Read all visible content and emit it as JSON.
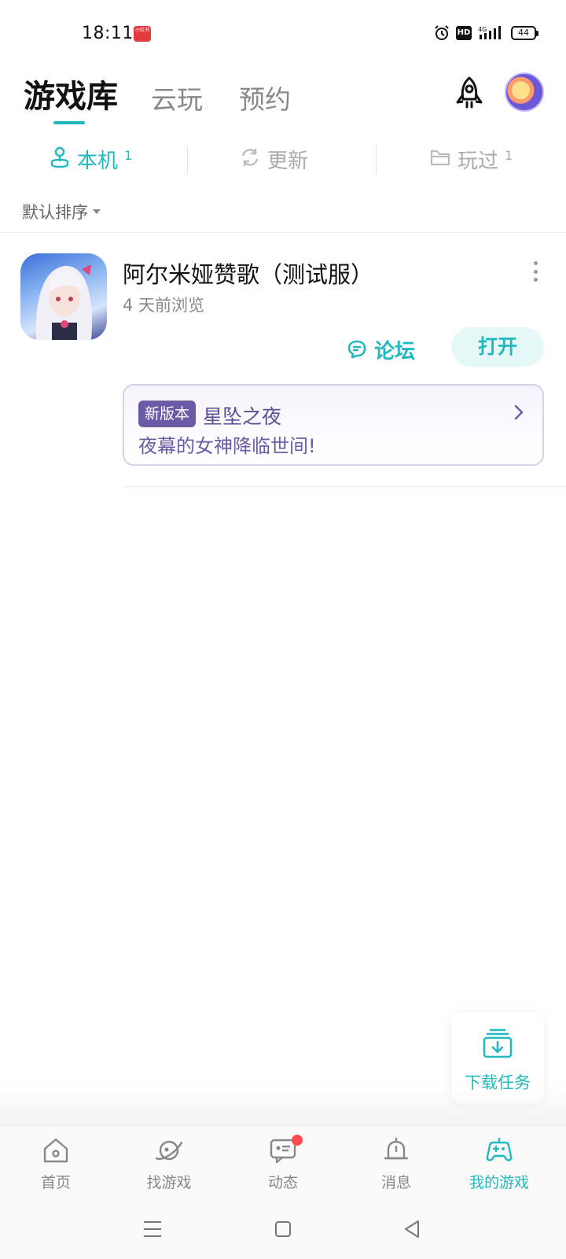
{
  "status": {
    "time": "18:11",
    "app_badge": "小红书",
    "hd": "HD",
    "battery": "44"
  },
  "header": {
    "tabs": [
      {
        "label": "游戏库",
        "active": true
      },
      {
        "label": "云玩",
        "active": false
      },
      {
        "label": "预约",
        "active": false
      }
    ]
  },
  "subtabs": [
    {
      "label": "本机",
      "count": "1",
      "active": true,
      "icon": "joystick-icon"
    },
    {
      "label": "更新",
      "count": "",
      "active": false,
      "icon": "refresh-icon"
    },
    {
      "label": "玩过",
      "count": "1",
      "active": false,
      "icon": "folder-icon"
    }
  ],
  "sort": {
    "label": "默认排序"
  },
  "game": {
    "title": "阿尔米娅赞歌（测试服）",
    "subtitle": "4 天前浏览",
    "forum_label": "论坛",
    "open_label": "打开",
    "news": {
      "badge": "新版本",
      "title": "星坠之夜",
      "desc": "夜幕的女神降临世间!"
    }
  },
  "download_task": {
    "label": "下载任务"
  },
  "bottom_nav": [
    {
      "label": "首页",
      "icon": "home-icon",
      "active": false
    },
    {
      "label": "找游戏",
      "icon": "planet-icon",
      "active": false
    },
    {
      "label": "动态",
      "icon": "chat-icon",
      "active": false,
      "badge_dot": true
    },
    {
      "label": "消息",
      "icon": "bell-icon",
      "active": false
    },
    {
      "label": "我的游戏",
      "icon": "gamepad-icon",
      "active": true
    }
  ],
  "colors": {
    "accent": "#22b8c0",
    "news_purple": "#6b5ba6",
    "notification": "#ff4d4d"
  }
}
